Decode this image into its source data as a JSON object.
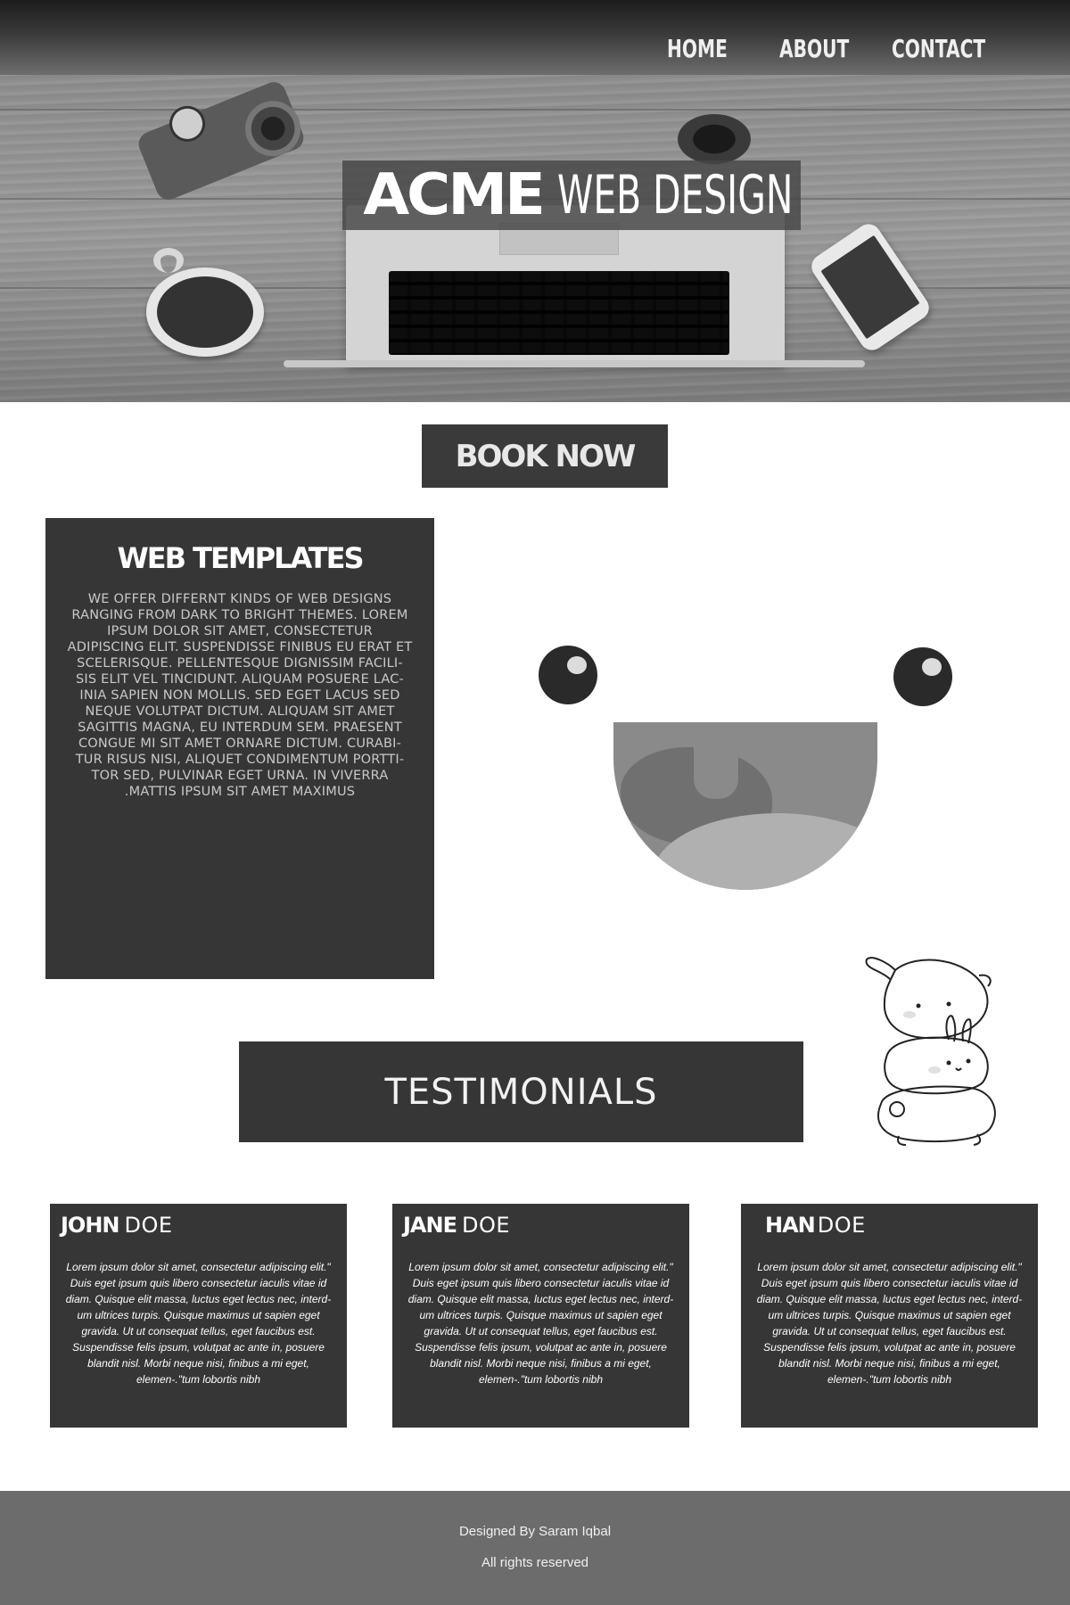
{
  "nav": {
    "items": [
      "HOME",
      "ABOUT",
      "CONTACT"
    ]
  },
  "hero": {
    "brand_bold": "ACME",
    "brand_light": "WEB DESIGN"
  },
  "cta": {
    "label": "BOOK NOW"
  },
  "templates": {
    "title": "WEB TEMPLATES",
    "body": "We offer differnt kinds of web designs ranging from dark to bright themes. Lorem ipsum dolor sit amet, consectetur adipiscing elit. Suspendisse finibus eu erat et scelerisque. Pellentesque dignissim facili-sis elit vel tincidunt. Aliquam posuere lac-inia sapien non mollis. Sed eget lacus sed neque volutpat dictum. Aliquam sit amet sagittis magna, eu interdum sem. Praesent congue mi sit amet ornare dictum. Curabi-tur risus nisi, aliquet condimentum portti-tor sed, pulvinar eget urna. In viverra .mattis ipsum sit amet maximus"
  },
  "testimonials": {
    "title": "TESTIMONIALS",
    "cards": [
      {
        "first": "JOHN",
        "last": "DOE",
        "quote": "Lorem ipsum dolor sit amet, consectetur adipiscing elit.\" Duis eget ipsum quis libero consectetur iaculis vitae id diam. Quisque elit massa, luctus eget lectus nec, interd-um ultrices turpis. Quisque maximus ut sapien eget gravida. Ut ut consequat tellus, eget faucibus est. Suspendisse felis ipsum, volutpat ac ante in, posuere blandit nisl. Morbi neque nisi, finibus a mi eget, elemen-.\"tum lobortis nibh"
      },
      {
        "first": "JANE",
        "last": "DOE",
        "quote": "Lorem ipsum dolor sit amet, consectetur adipiscing elit.\" Duis eget ipsum quis libero consectetur iaculis vitae id diam. Quisque elit massa, luctus eget lectus nec, interd-um ultrices turpis. Quisque maximus ut sapien eget gravida. Ut ut consequat tellus, eget faucibus est. Suspendisse felis ipsum, volutpat ac ante in, posuere blandit nisl. Morbi neque nisi, finibus a mi eget, elemen-.\"tum lobortis nibh"
      },
      {
        "first": "HAN",
        "last": "DOE",
        "quote": "Lorem ipsum dolor sit amet, consectetur adipiscing elit.\" Duis eget ipsum quis libero consectetur iaculis vitae id diam. Quisque elit massa, luctus eget lectus nec, interd-um ultrices turpis. Quisque maximus ut sapien eget gravida. Ut ut consequat tellus, eget faucibus est. Suspendisse felis ipsum, volutpat ac ante in, posuere blandit nisl. Morbi neque nisi, finibus a mi eget, elemen-.\"tum lobortis nibh"
      }
    ]
  },
  "footer": {
    "credit": "Designed By Saram Iqbal",
    "rights": "All rights reserved"
  },
  "colors": {
    "panel": "#363636",
    "footer": "#6c6c6c",
    "text_light": "#ffffff"
  }
}
